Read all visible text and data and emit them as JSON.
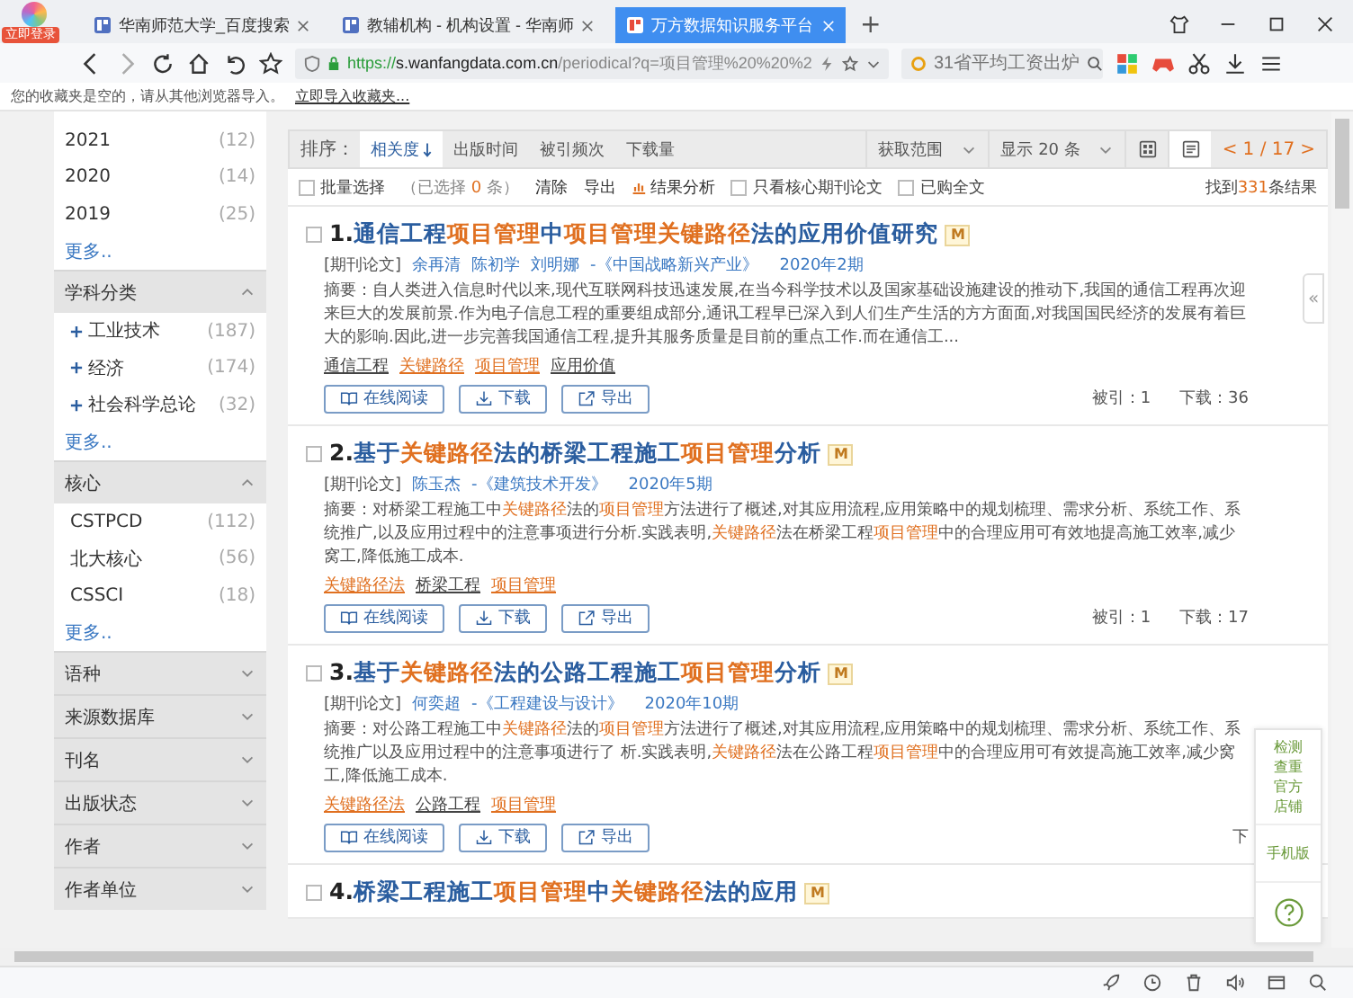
{
  "browser": {
    "login_badge": "立即登录",
    "tabs": [
      {
        "title": "华南师范大学_百度搜索",
        "selected": false
      },
      {
        "title": "教辅机构 - 机构设置 - 华南师",
        "selected": false
      },
      {
        "title": "万方数据知识服务平台",
        "selected": true
      }
    ],
    "new_tab": "+",
    "url": {
      "scheme": "https://",
      "host": "s.wanfangdata.com.cn",
      "path": "/periodical?q=项目管理%20%20%2"
    },
    "search": {
      "value": "31省平均工资出炉"
    },
    "bookmarks": {
      "note": "您的收藏夹是空的，请从其他浏览器导入。",
      "link": "立即导入收藏夹..."
    }
  },
  "sidebar": {
    "top_items": [
      {
        "label": "2021",
        "count": "(12)"
      },
      {
        "label": "2020",
        "count": "(14)"
      },
      {
        "label": "2019",
        "count": "(25)"
      }
    ],
    "top_more": "更多..",
    "sections": [
      {
        "title": "学科分类",
        "expanded": true,
        "more": "更多..",
        "items": [
          {
            "label": "工业技术",
            "count": "(187)",
            "expandable": true
          },
          {
            "label": "经济",
            "count": "(174)",
            "expandable": true
          },
          {
            "label": "社会科学总论",
            "count": "(32)",
            "expandable": true
          }
        ]
      },
      {
        "title": "核心",
        "expanded": true,
        "more": "更多..",
        "items": [
          {
            "label": "CSTPCD",
            "count": "(112)",
            "expandable": false
          },
          {
            "label": "北大核心",
            "count": "(56)",
            "expandable": false
          },
          {
            "label": "CSSCI",
            "count": "(18)",
            "expandable": false
          }
        ]
      },
      {
        "title": "语种",
        "expanded": false
      },
      {
        "title": "来源数据库",
        "expanded": false
      },
      {
        "title": "刊名",
        "expanded": false
      },
      {
        "title": "出版状态",
        "expanded": false
      },
      {
        "title": "作者",
        "expanded": false
      },
      {
        "title": "作者单位",
        "expanded": false
      }
    ]
  },
  "toolbar": {
    "sort_label": "排序：",
    "sort_options": [
      {
        "label": "相关度",
        "selected": true
      },
      {
        "label": "出版时间",
        "selected": false
      },
      {
        "label": "被引频次",
        "selected": false
      },
      {
        "label": "下载量",
        "selected": false
      }
    ],
    "range": "获取范围",
    "page_size": "显示 20 条",
    "views": [
      {
        "kind": "grid",
        "selected": false
      },
      {
        "kind": "list",
        "selected": true
      }
    ],
    "pager": {
      "prev": "<",
      "current": "1 / 17",
      "next": ">"
    }
  },
  "filters": {
    "batch": {
      "label": "批量选择",
      "checked": false
    },
    "selected_before": "（已选择",
    "selected_count": "0",
    "selected_after": "条）",
    "clear": "清除",
    "export": "导出",
    "analysis": "结果分析",
    "options": [
      {
        "label": "只看核心期刊论文",
        "checked": false
      },
      {
        "label": "已购全文",
        "checked": false
      }
    ],
    "found_before": "找到",
    "found_count": "331",
    "found_after": "条结果"
  },
  "results": [
    {
      "number": "1.",
      "selected": false,
      "badge": "M",
      "title": [
        {
          "text": "通信工程",
          "highlight": false
        },
        {
          "text": "项目管理",
          "highlight": true
        },
        {
          "text": "中",
          "highlight": false
        },
        {
          "text": "项目管理关键路径",
          "highlight": true
        },
        {
          "text": "法的应用价值研究",
          "highlight": false
        }
      ],
      "type": "[期刊论文]",
      "authors": [
        "余再清",
        "陈初学",
        "刘明娜"
      ],
      "journal": "-《中国战略新兴产业》",
      "issue": "2020年2期",
      "abstract": [
        {
          "text": "摘要：自人类进入信息时代以来,现代互联网科技迅速发展,在当今科学技术以及国家基础设施建设的推动下,我国的通信工程再次迎来巨大的发展前景.作为电子信息工程的重要组成部分,通讯工程早已深入到人们生产生活的方方面面,对我国国民经济的发展有着巨大的影响.因此,进一步完善我国通信工程,提升其服务质量是目前的重点工作.而在通信工...",
          "highlight": false
        }
      ],
      "keywords": [
        {
          "text": "通信工程",
          "highlight": false
        },
        {
          "text": "关键路径",
          "highlight": true
        },
        {
          "text": "项目管理",
          "highlight": true
        },
        {
          "text": "应用价值",
          "highlight": false
        }
      ],
      "actions": [
        "在线阅读",
        "下载",
        "导出"
      ],
      "stats": [
        "被引：1",
        "下载：36"
      ]
    },
    {
      "number": "2.",
      "selected": false,
      "badge": "M",
      "title": [
        {
          "text": "基于",
          "highlight": false
        },
        {
          "text": "关键路径",
          "highlight": true
        },
        {
          "text": "法的桥梁工程施工",
          "highlight": false
        },
        {
          "text": "项目管理",
          "highlight": true
        },
        {
          "text": "分析",
          "highlight": false
        }
      ],
      "type": "[期刊论文]",
      "authors": [
        "陈玉杰"
      ],
      "journal": "-《建筑技术开发》",
      "issue": "2020年5期",
      "abstract": [
        {
          "text": "摘要：对桥梁工程施工中",
          "highlight": false
        },
        {
          "text": "关键路径",
          "highlight": true
        },
        {
          "text": "法的",
          "highlight": false
        },
        {
          "text": "项目管理",
          "highlight": true
        },
        {
          "text": "方法进行了概述,对其应用流程,应用策略中的规划梳理、需求分析、系统工作、系统推广,以及应用过程中的注意事项进行分析.实践表明,",
          "highlight": false
        },
        {
          "text": "关键路径",
          "highlight": true
        },
        {
          "text": "法在桥梁工程",
          "highlight": false
        },
        {
          "text": "项目管理",
          "highlight": true
        },
        {
          "text": "中的合理应用可有效地提高施工效率,减少窝工,降低施工成本.",
          "highlight": false
        }
      ],
      "keywords": [
        {
          "text": "关键路径法",
          "highlight": true
        },
        {
          "text": "桥梁工程",
          "highlight": false
        },
        {
          "text": "项目管理",
          "highlight": true
        }
      ],
      "actions": [
        "在线阅读",
        "下载",
        "导出"
      ],
      "stats": [
        "被引：1",
        "下载：17"
      ]
    },
    {
      "number": "3.",
      "selected": false,
      "badge": "M",
      "title": [
        {
          "text": "基于",
          "highlight": false
        },
        {
          "text": "关键路径",
          "highlight": true
        },
        {
          "text": "法的公路工程施工",
          "highlight": false
        },
        {
          "text": "项目管理",
          "highlight": true
        },
        {
          "text": "分析",
          "highlight": false
        }
      ],
      "type": "[期刊论文]",
      "authors": [
        "何奕超"
      ],
      "journal": "-《工程建设与设计》",
      "issue": "2020年10期",
      "abstract": [
        {
          "text": "摘要：对公路工程施工中",
          "highlight": false
        },
        {
          "text": "关键路径",
          "highlight": true
        },
        {
          "text": "法的",
          "highlight": false
        },
        {
          "text": "项目管理",
          "highlight": true
        },
        {
          "text": "方法进行了概述,对其应用流程,应用策略中的规划梳理、需求分析、系统工作、系统推广以及应用过程中的注意事项进行了 析.实践表明,",
          "highlight": false
        },
        {
          "text": "关键路径",
          "highlight": true
        },
        {
          "text": "法在公路工程",
          "highlight": false
        },
        {
          "text": "项目管理",
          "highlight": true
        },
        {
          "text": "中的合理应用可有效提高施工效率,减少窝工,降低施工成本.",
          "highlight": false
        }
      ],
      "keywords": [
        {
          "text": "关键路径法",
          "highlight": true
        },
        {
          "text": "公路工程",
          "highlight": false
        },
        {
          "text": "项目管理",
          "highlight": true
        }
      ],
      "actions": [
        "在线阅读",
        "下载",
        "导出"
      ],
      "stats": [
        "下"
      ]
    },
    {
      "number": "4.",
      "selected": false,
      "badge": "M",
      "title": [
        {
          "text": "桥梁工程施工",
          "highlight": false
        },
        {
          "text": "项目管理",
          "highlight": true
        },
        {
          "text": "中",
          "highlight": false
        },
        {
          "text": "关键路径",
          "highlight": true
        },
        {
          "text": "法的应用",
          "highlight": false
        }
      ]
    }
  ],
  "float_panel": {
    "shop": "检测查重官方店铺",
    "mobile": "手机版"
  },
  "collapse_handle": "«"
}
